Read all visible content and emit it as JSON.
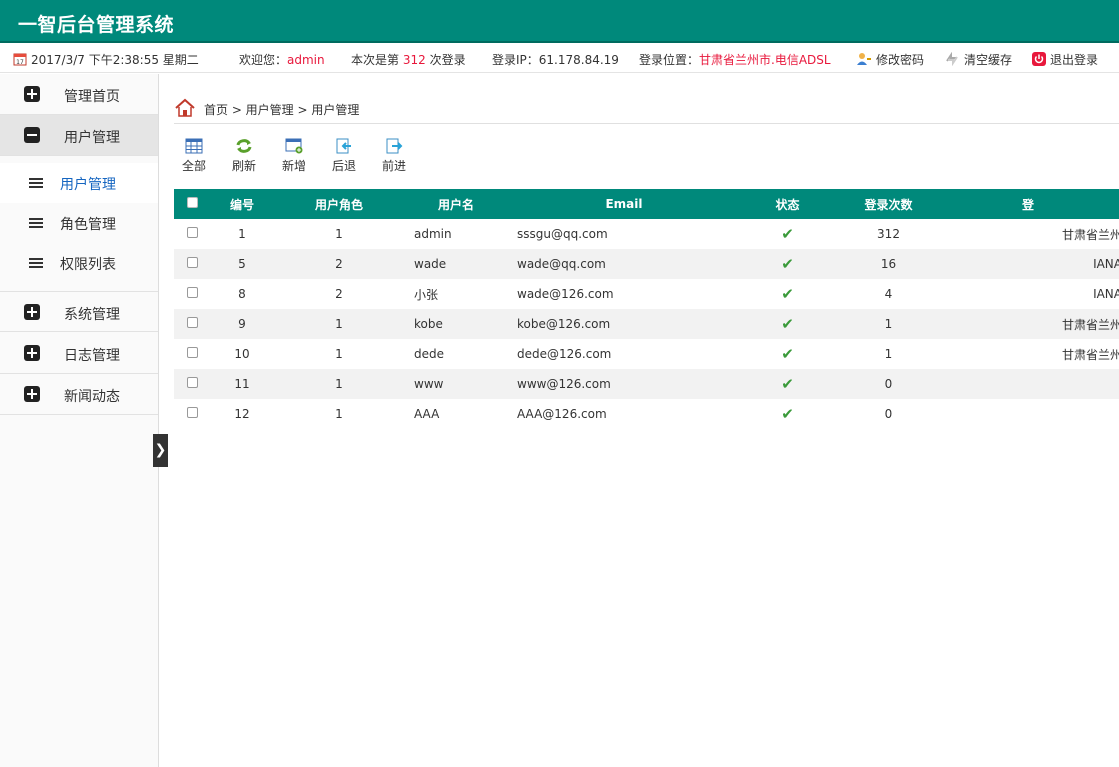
{
  "app": {
    "title": "一智后台管理系统"
  },
  "infobar": {
    "datetime": "2017/3/7 下午2:38:55 星期二",
    "welcome_prefix": "欢迎您：",
    "username": "admin",
    "login_count_prefix": "本次是第",
    "login_count": "312",
    "login_count_suffix": "次登录",
    "ip": "登录IP：61.178.84.19",
    "location_prefix": "登录位置：",
    "location": "甘肃省兰州市.电信ADSL",
    "change_password": "修改密码",
    "clear_cache": "清空缓存",
    "logout": "退出登录"
  },
  "sidebar": {
    "menus": [
      {
        "label": "管理首页"
      },
      {
        "label": "用户管理"
      },
      {
        "label": "系统管理"
      },
      {
        "label": "日志管理"
      },
      {
        "label": "新闻动态"
      }
    ],
    "submenu": [
      {
        "label": "用户管理"
      },
      {
        "label": "角色管理"
      },
      {
        "label": "权限列表"
      }
    ],
    "collapse_glyph": "❯"
  },
  "breadcrumb": {
    "text": "首页 > 用户管理 > 用户管理"
  },
  "toolbar": {
    "all": "全部",
    "refresh": "刷新",
    "add": "新增",
    "back": "后退",
    "forward": "前进"
  },
  "table": {
    "headers": [
      "编号",
      "用户角色",
      "用户名",
      "Email",
      "状态",
      "登录次数",
      "登"
    ],
    "rows": [
      {
        "id": "1",
        "role": "1",
        "name": "admin",
        "email": "sssgu@qq.com",
        "status": "✔",
        "logins": "312",
        "loc": "甘肃省兰州"
      },
      {
        "id": "5",
        "role": "2",
        "name": "wade",
        "email": "wade@qq.com",
        "status": "✔",
        "logins": "16",
        "loc": "IANA"
      },
      {
        "id": "8",
        "role": "2",
        "name": "小张",
        "email": "wade@126.com",
        "status": "✔",
        "logins": "4",
        "loc": "IANA"
      },
      {
        "id": "9",
        "role": "1",
        "name": "kobe",
        "email": "kobe@126.com",
        "status": "✔",
        "logins": "1",
        "loc": "甘肃省兰州"
      },
      {
        "id": "10",
        "role": "1",
        "name": "dede",
        "email": "dede@126.com",
        "status": "✔",
        "logins": "1",
        "loc": "甘肃省兰州"
      },
      {
        "id": "11",
        "role": "1",
        "name": "www",
        "email": "www@126.com",
        "status": "✔",
        "logins": "0",
        "loc": ""
      },
      {
        "id": "12",
        "role": "1",
        "name": "AAA",
        "email": "AAA@126.com",
        "status": "✔",
        "logins": "0",
        "loc": ""
      }
    ]
  },
  "colors": {
    "header": "#00897b",
    "accent_red": "#e8183c",
    "check": "#3a9a3a"
  }
}
